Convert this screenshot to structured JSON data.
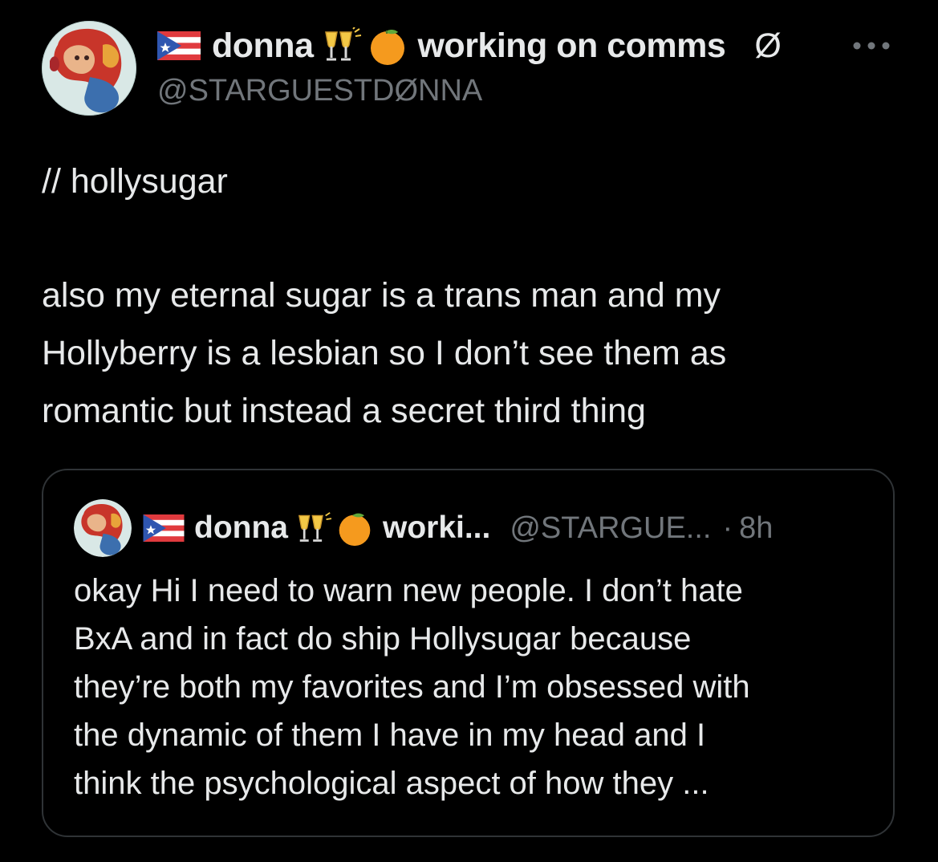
{
  "colors": {
    "background": "#000000",
    "text_primary": "#e7e9ea",
    "text_secondary": "#71767b",
    "card_border": "#2f3336"
  },
  "tweet": {
    "author": {
      "display_name_prefix": "donna",
      "display_name_suffix": "working on comms",
      "name_symbol": "Ø",
      "handle": "@STARGUESTDØNNA",
      "avatar_icon": "avatar-red-hair-character",
      "flag_icon": "puerto-rico-flag-icon",
      "emoji_icons": [
        "champagne-cheers-icon",
        "orange-icon"
      ]
    },
    "more_label": "···",
    "text_line1": "// hollysugar",
    "text_body": "also my eternal sugar is a trans man and my\nHollyberry is a lesbian so I don’t see them as\nromantic but instead a secret third thing"
  },
  "quote": {
    "display_name": "donna",
    "status_truncated": "worki...",
    "handle_truncated": "@STARGUE...",
    "separator": "·",
    "time": "8h",
    "text": "okay Hi I need to warn new people. I don’t hate\nBxA and in fact do ship Hollysugar because\nthey’re both my favorites and I’m obsessed with\nthe dynamic of them I have in my head and I\nthink the psychological aspect of how they ..."
  }
}
